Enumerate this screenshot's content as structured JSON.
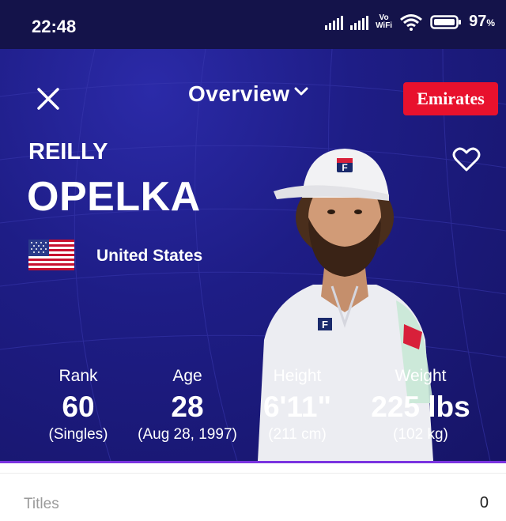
{
  "status_bar": {
    "time": "22:48",
    "vowifi_top": "Vo",
    "vowifi_bottom": "WiFi",
    "battery": "97",
    "battery_unit": "%"
  },
  "header": {
    "title": "Overview",
    "sponsor": "Emirates"
  },
  "player": {
    "first_name": "REILLY",
    "last_name": "OPELKA",
    "country": "United States",
    "shirt_logo": "F"
  },
  "stats": [
    {
      "label": "Rank",
      "value": "60",
      "sub": "(Singles)"
    },
    {
      "label": "Age",
      "value": "28",
      "sub": "(Aug 28, 1997)"
    },
    {
      "label": "Height",
      "value": "6'11\"",
      "sub": "(211 cm)"
    },
    {
      "label": "Weight",
      "value": "225 lbs",
      "sub": "(102 kg)"
    }
  ],
  "details": {
    "label": "Titles",
    "value": "0"
  },
  "colors": {
    "hero_background": "#1e1d86",
    "status_bar": "#14134a",
    "sponsor_red": "#e8112d",
    "accent_line": "#7a33e0"
  },
  "icons": [
    "signal-icon",
    "vowifi-icon",
    "wifi-icon",
    "battery-icon",
    "close-icon",
    "chevron-down-icon",
    "heart-icon",
    "us-flag-icon"
  ]
}
